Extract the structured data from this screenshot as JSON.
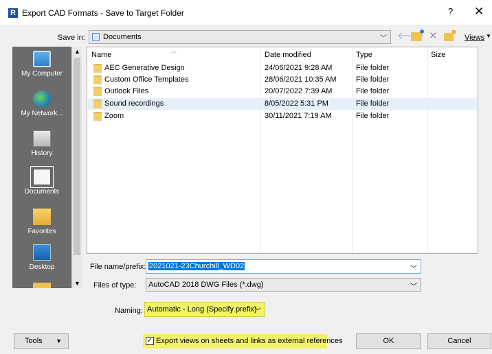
{
  "window": {
    "title": "Export CAD Formats - Save to Target Folder",
    "app_icon_letter": "R",
    "help": "?",
    "close": "✕"
  },
  "save_in": {
    "label": "Save in:",
    "value": "Documents"
  },
  "toolbar": {
    "views_label": "Views"
  },
  "places": [
    {
      "label": "My Computer",
      "icon": "computer-icon"
    },
    {
      "label": "My Network...",
      "icon": "network-globe-icon"
    },
    {
      "label": "History",
      "icon": "history-icon"
    },
    {
      "label": "Documents",
      "icon": "documents-icon",
      "selected": true
    },
    {
      "label": "Favorites",
      "icon": "favorites-icon"
    },
    {
      "label": "Desktop",
      "icon": "desktop-icon"
    }
  ],
  "file_list": {
    "columns": [
      "Name",
      "Date modified",
      "Type",
      "Size"
    ],
    "rows": [
      {
        "name": "AEC Generative Design",
        "date": "24/06/2021 9:28 AM",
        "type": "File folder",
        "size": ""
      },
      {
        "name": "Custom Office Templates",
        "date": "28/06/2021 10:35 AM",
        "type": "File folder",
        "size": ""
      },
      {
        "name": "Outlook Files",
        "date": "20/07/2022 7:39 AM",
        "type": "File folder",
        "size": ""
      },
      {
        "name": "Sound recordings",
        "date": "8/05/2022 5:31 PM",
        "type": "File folder",
        "size": "",
        "selected": true
      },
      {
        "name": "Zoom",
        "date": "30/11/2021 7:19 AM",
        "type": "File folder",
        "size": ""
      }
    ]
  },
  "file_name": {
    "label": "File name/prefix:",
    "value": "2021021-23Churchill_WD02"
  },
  "file_type": {
    "label": "Files of type:",
    "value": "AutoCAD 2018 DWG Files  (*.dwg)"
  },
  "naming": {
    "label": "Naming:",
    "value": "Automatic - Long (Specify prefix)"
  },
  "export_option": {
    "label": "Export views on sheets and links as external references",
    "checked": true
  },
  "buttons": {
    "tools": "Tools",
    "ok": "OK",
    "cancel": "Cancel"
  },
  "colors": {
    "highlight": "#f1f16a",
    "selection": "#0078d7",
    "places_bg": "#6b6b6b"
  }
}
